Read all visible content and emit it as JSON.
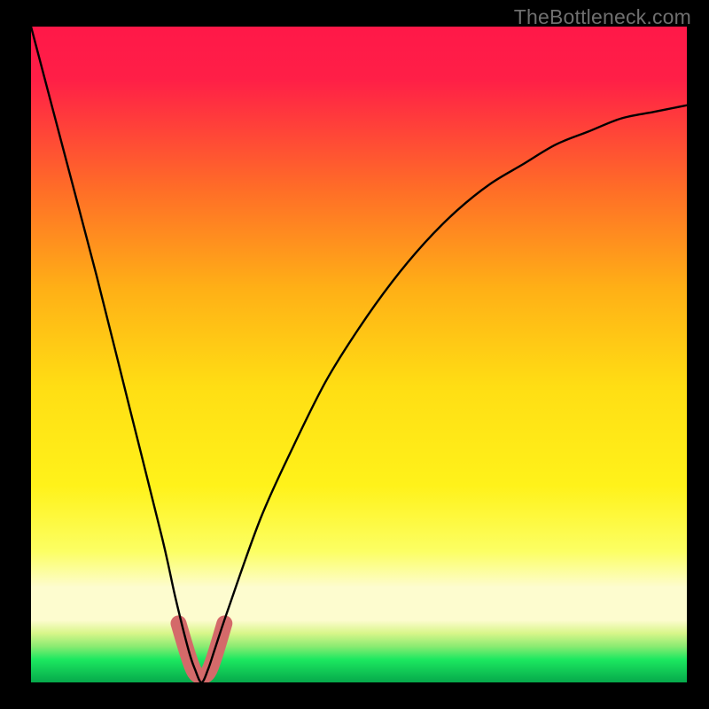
{
  "watermark": "TheBottleneck.com",
  "palette": {
    "frame": "#000000",
    "curve": "#000000",
    "highlight": "#d46a6a",
    "top": "#ff1848",
    "mid_upper": "#ff8e16",
    "mid": "#ffe714",
    "band": "#fdfccf",
    "green_light": "#8beb72",
    "green": "#1ce860",
    "green_deep": "#06a94b"
  },
  "chart_data": {
    "type": "line",
    "title": "",
    "xlabel": "",
    "ylabel": "",
    "xlim": [
      0,
      100
    ],
    "ylim": [
      0,
      100
    ],
    "x_min_point": 26,
    "series": [
      {
        "name": "bottleneck-curve",
        "x": [
          0,
          5,
          10,
          15,
          20,
          22,
          24,
          25,
          26,
          27,
          28,
          30,
          35,
          40,
          45,
          50,
          55,
          60,
          65,
          70,
          75,
          80,
          85,
          90,
          95,
          100
        ],
        "values": [
          100,
          81,
          62,
          42,
          22,
          13,
          5,
          2,
          0,
          2,
          5,
          11,
          25,
          36,
          46,
          54,
          61,
          67,
          72,
          76,
          79,
          82,
          84,
          86,
          87,
          88
        ]
      }
    ],
    "background_gradient": {
      "stops": [
        {
          "pos": 0.0,
          "color": "#ff1848"
        },
        {
          "pos": 0.08,
          "color": "#ff1f47"
        },
        {
          "pos": 0.25,
          "color": "#ff6e27"
        },
        {
          "pos": 0.4,
          "color": "#ffb016"
        },
        {
          "pos": 0.55,
          "color": "#ffde14"
        },
        {
          "pos": 0.7,
          "color": "#fff21a"
        },
        {
          "pos": 0.8,
          "color": "#fcff63"
        },
        {
          "pos": 0.855,
          "color": "#fdfccf"
        },
        {
          "pos": 0.905,
          "color": "#fdfccf"
        },
        {
          "pos": 0.925,
          "color": "#d8f68a"
        },
        {
          "pos": 0.945,
          "color": "#8beb72"
        },
        {
          "pos": 0.965,
          "color": "#1ce860"
        },
        {
          "pos": 1.0,
          "color": "#06a94b"
        }
      ]
    },
    "highlight_segment": {
      "name": "min-region",
      "x": [
        22.5,
        24,
        25,
        26,
        27,
        28,
        29.5
      ],
      "values": [
        9,
        4,
        1.5,
        1,
        1.5,
        4,
        9
      ]
    }
  }
}
